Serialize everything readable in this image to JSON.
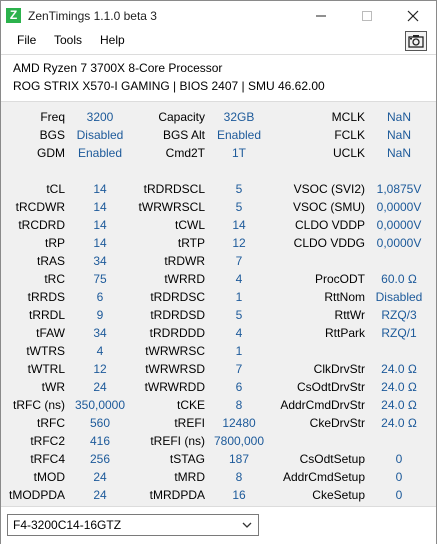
{
  "window": {
    "title": "ZenTimings 1.1.0 beta 3",
    "icon_letter": "Z"
  },
  "menu": {
    "file": "File",
    "tools": "Tools",
    "help": "Help"
  },
  "system": {
    "cpu": "AMD Ryzen 7 3700X 8-Core Processor",
    "board": "ROG STRIX X570-I GAMING | BIOS 2407 | SMU 46.62.00"
  },
  "top": {
    "freq_label": "Freq",
    "freq": "3200",
    "capacity_label": "Capacity",
    "capacity": "32GB",
    "mclk_label": "MCLK",
    "mclk": "NaN",
    "bgs_label": "BGS",
    "bgs": "Disabled",
    "bgsalt_label": "BGS Alt",
    "bgsalt": "Enabled",
    "fclk_label": "FCLK",
    "fclk": "NaN",
    "gdm_label": "GDM",
    "gdm": "Enabled",
    "cmd2t_label": "Cmd2T",
    "cmd2t": "1T",
    "uclk_label": "UCLK",
    "uclk": "NaN"
  },
  "timings": {
    "col1": [
      {
        "label": "tCL",
        "value": "14"
      },
      {
        "label": "tRCDWR",
        "value": "14"
      },
      {
        "label": "tRCDRD",
        "value": "14"
      },
      {
        "label": "tRP",
        "value": "14"
      },
      {
        "label": "tRAS",
        "value": "34"
      },
      {
        "label": "tRC",
        "value": "75"
      },
      {
        "label": "tRRDS",
        "value": "6"
      },
      {
        "label": "tRRDL",
        "value": "9"
      },
      {
        "label": "tFAW",
        "value": "34"
      },
      {
        "label": "tWTRS",
        "value": "4"
      },
      {
        "label": "tWTRL",
        "value": "12"
      },
      {
        "label": "tWR",
        "value": "24"
      },
      {
        "label": "tRFC (ns)",
        "value": "350,0000"
      },
      {
        "label": "tRFC",
        "value": "560"
      },
      {
        "label": "tRFC2",
        "value": "416"
      },
      {
        "label": "tRFC4",
        "value": "256"
      },
      {
        "label": "tMOD",
        "value": "24"
      },
      {
        "label": "tMODPDA",
        "value": "24"
      }
    ],
    "col2": [
      {
        "label": "tRDRDSCL",
        "value": "5"
      },
      {
        "label": "tWRWRSCL",
        "value": "5"
      },
      {
        "label": "tCWL",
        "value": "14"
      },
      {
        "label": "tRTP",
        "value": "12"
      },
      {
        "label": "tRDWR",
        "value": "7"
      },
      {
        "label": "tWRRD",
        "value": "4"
      },
      {
        "label": "tRDRDSC",
        "value": "1"
      },
      {
        "label": "tRDRDSD",
        "value": "5"
      },
      {
        "label": "tRDRDDD",
        "value": "4"
      },
      {
        "label": "tWRWRSC",
        "value": "1"
      },
      {
        "label": "tWRWRSD",
        "value": "7"
      },
      {
        "label": "tWRWRDD",
        "value": "6"
      },
      {
        "label": "tCKE",
        "value": "8"
      },
      {
        "label": "tREFI",
        "value": "12480"
      },
      {
        "label": "tREFI (ns)",
        "value": "7800,000"
      },
      {
        "label": "tSTAG",
        "value": "187"
      },
      {
        "label": "tMRD",
        "value": "8"
      },
      {
        "label": "tMRDPDA",
        "value": "16"
      }
    ],
    "col3": [
      {
        "label": "VSOC (SVI2)",
        "value": "1,0875V"
      },
      {
        "label": "VSOC (SMU)",
        "value": "0,0000V"
      },
      {
        "label": "CLDO VDDP",
        "value": "0,0000V"
      },
      {
        "label": "CLDO VDDG",
        "value": "0,0000V"
      },
      {
        "label": "",
        "value": ""
      },
      {
        "label": "ProcODT",
        "value": "60.0 Ω"
      },
      {
        "label": "RttNom",
        "value": "Disabled"
      },
      {
        "label": "RttWr",
        "value": "RZQ/3"
      },
      {
        "label": "RttPark",
        "value": "RZQ/1"
      },
      {
        "label": "",
        "value": ""
      },
      {
        "label": "ClkDrvStr",
        "value": "24.0 Ω"
      },
      {
        "label": "CsOdtDrvStr",
        "value": "24.0 Ω"
      },
      {
        "label": "AddrCmdDrvStr",
        "value": "24.0 Ω"
      },
      {
        "label": "CkeDrvStr",
        "value": "24.0 Ω"
      },
      {
        "label": "",
        "value": ""
      },
      {
        "label": "CsOdtSetup",
        "value": "0"
      },
      {
        "label": "AddrCmdSetup",
        "value": "0"
      },
      {
        "label": "CkeSetup",
        "value": "0"
      }
    ]
  },
  "profile": {
    "selected": "F4-3200C14-16GTZ"
  },
  "colors": {
    "value_text": "#1d5a9a",
    "panel_bg": "#f0f0f0",
    "icon_green": "#2bb24c"
  }
}
